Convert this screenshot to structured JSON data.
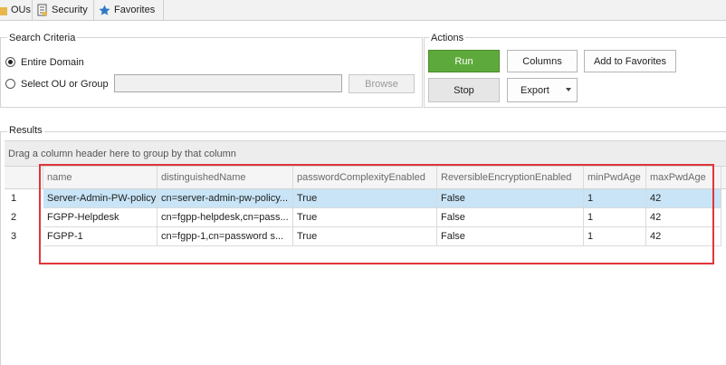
{
  "tabs": [
    {
      "label": "OUs",
      "icon": "folder-icon"
    },
    {
      "label": "Security",
      "icon": "document-icon"
    },
    {
      "label": "Favorites",
      "icon": "star-icon"
    }
  ],
  "search": {
    "title": "Search Criteria",
    "option_entire": "Entire Domain",
    "option_ou": "Select OU or Group",
    "ou_value": "",
    "browse_label": "Browse"
  },
  "actions": {
    "title": "Actions",
    "run": "Run",
    "columns": "Columns",
    "add_favorites": "Add to Favorites",
    "stop": "Stop",
    "export": "Export"
  },
  "results": {
    "title": "Results",
    "group_hint": "Drag a column header here to group by that column",
    "columns": [
      "name",
      "distinguishedName",
      "passwordComplexityEnabled",
      "ReversibleEncryptionEnabled",
      "minPwdAge",
      "maxPwdAge"
    ],
    "rows": [
      {
        "num": "1",
        "cells": [
          "Server-Admin-PW-policy",
          "cn=server-admin-pw-policy...",
          "True",
          "False",
          "1",
          "42"
        ]
      },
      {
        "num": "2",
        "cells": [
          "FGPP-Helpdesk",
          "cn=fgpp-helpdesk,cn=pass...",
          "True",
          "False",
          "1",
          "42"
        ]
      },
      {
        "num": "3",
        "cells": [
          "FGPP-1",
          "cn=fgpp-1,cn=password s...",
          "True",
          "False",
          "1",
          "42"
        ]
      }
    ]
  },
  "colors": {
    "run_button": "#5ea93b",
    "selected_row": "#c8e4f6",
    "highlight_border": "#e0353b"
  }
}
